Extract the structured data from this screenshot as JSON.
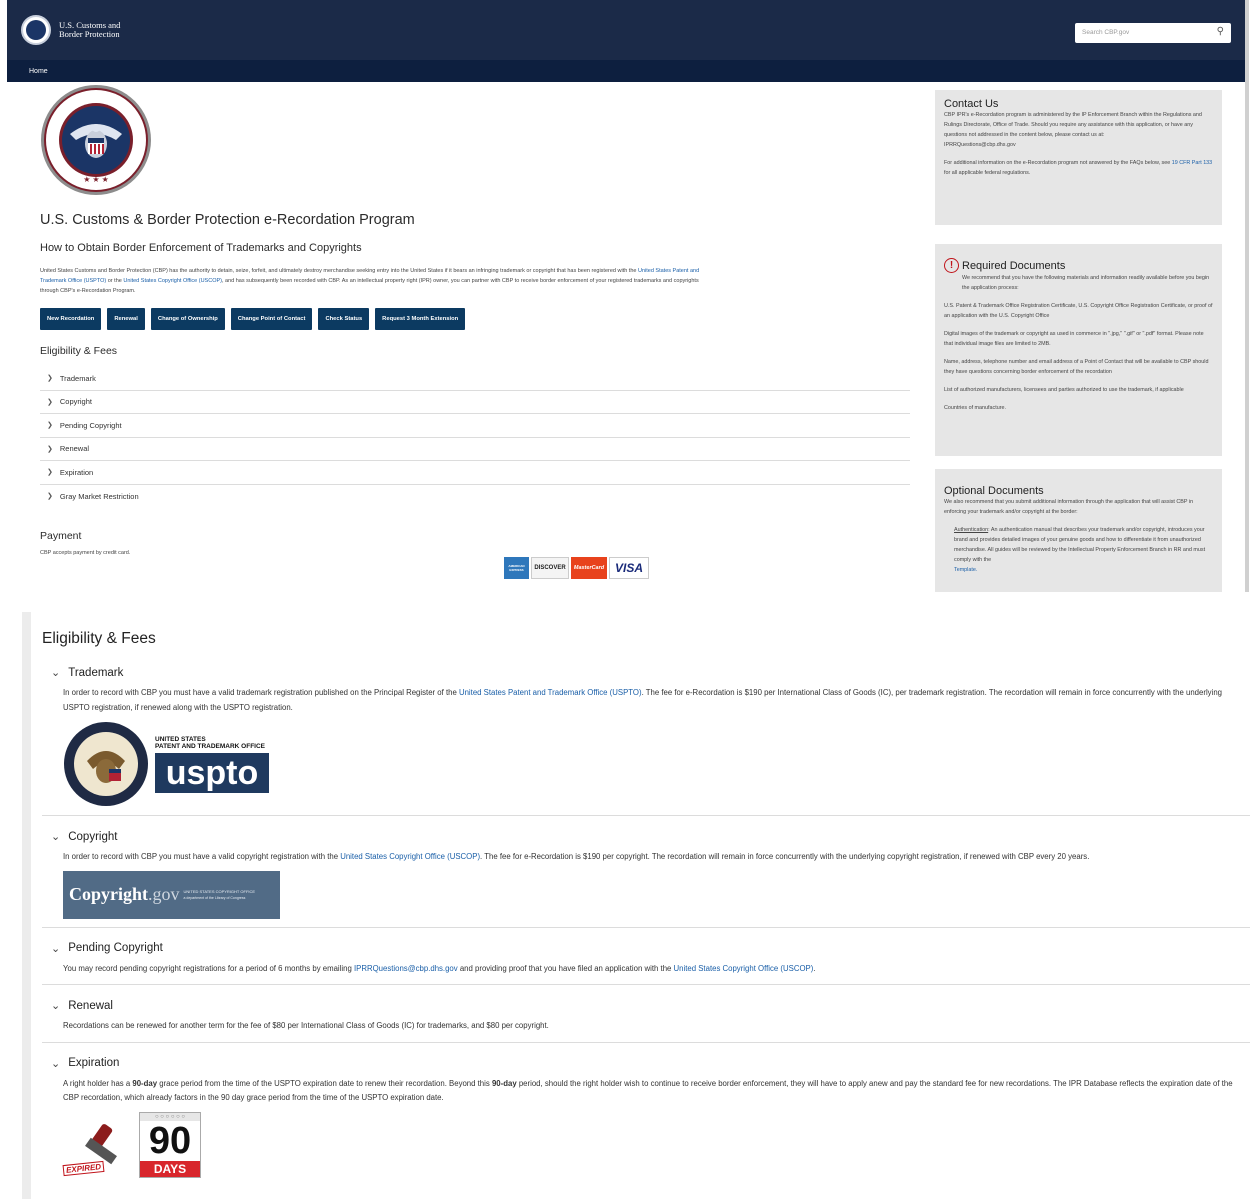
{
  "header": {
    "brand_line1": "U.S. Customs and",
    "brand_line2": "Border Protection",
    "search_placeholder": "Search CBP.gov",
    "nav_home": "Home"
  },
  "main": {
    "logo_text_top": "CUSTOMS AND BORDER PROTECTION",
    "logo_text_bottom": "TRADE",
    "title": "U.S. Customs & Border Protection e-Recordation Program",
    "subtitle": "How to Obtain Border Enforcement of Trademarks and Copyrights",
    "intro_1": "United States Customs and Border Protection (CBP) has the authority to detain, seize, forfeit, and ultimately destroy merchandise seeking entry into the United States if it bears an infringing trademark or copyright that has been registered with the ",
    "intro_link1": "United States Patent and Trademark Office (USPTO)",
    "intro_2": " or the ",
    "intro_link2": "United States Copyright Office (USCOP)",
    "intro_3": ", and has subsequently been recorded with CBP. As an intellectual property right (IPR) owner, you can partner with CBP to receive border enforcement of your registered trademarks and copyrights through CBP's e-Recordation Program.",
    "buttons": [
      "New Recordation",
      "Renewal",
      "Change of Ownership",
      "Change Point of Contact",
      "Check Status",
      "Request 3 Month Extension"
    ],
    "eligibility_title": "Eligibility & Fees",
    "accordion": [
      "Trademark",
      "Copyright",
      "Pending Copyright",
      "Renewal",
      "Expiration",
      "Gray Market Restriction"
    ],
    "payment_title": "Payment",
    "payment_text": "CBP accepts payment by credit card.",
    "cards": [
      "AMERICAN EXPRESS",
      "DISCOVER",
      "MasterCard",
      "VISA"
    ]
  },
  "sidebar": {
    "contact_title": "Contact Us",
    "contact_text": "CBP IPR's e-Recordation program is administered by the IP Enforcement Branch within the Regulations and Rulings Directorate, Office of Trade. Should you require any assistance with this application, or have any questions not addressed in the content below, please contact us at:",
    "contact_email": "IPRRQuestions@cbp.dhs.gov",
    "contact_more_1": "For additional information on the e-Recordation program not answered by the FAQs below, see ",
    "contact_more_link": "19 CFR Part 133",
    "contact_more_2": " for all applicable federal regulations.",
    "required_title": "Required Documents",
    "required_intro": "We recommend that you have the following materials and information readily available before you begin the application process:",
    "required_items": [
      "U.S. Patent & Trademark Office Registration Certificate, U.S. Copyright Office Registration Certificate, or proof of an application with the U.S. Copyright Office",
      "Digital images of the trademark or copyright as used in commerce in \".jpg,\" \".gif\" or \".pdf\" format. Please note that individual image files are limited to 2MB.",
      "Name, address, telephone number and email address of a Point of Contact that will be available to CBP should they have questions concerning border enforcement of the recordation",
      "List of authorized manufacturers, licensees and parties authorized to use the trademark, if applicable",
      "Countries of manufacture."
    ],
    "optional_title": "Optional Documents",
    "optional_intro": "We also recommend that you submit additional information through the application that will assist CBP in enforcing your trademark and/or copyright at the border:",
    "optional_auth_label": "Authentication",
    "optional_auth_text": ": An authentication manual that describes your trademark and/or copyright, introduces your brand and provides detailed images of your genuine goods and how to differentiate it from unauthorized merchandise. All guides will be reviewed by the Intellectual Property Enforcement Branch in RR and must comply with the ",
    "optional_template": "Template."
  },
  "expanded": {
    "title": "Eligibility & Fees",
    "trademark": {
      "label": "Trademark",
      "text_1": "In order to record with CBP you must have a valid trademark registration published on the Principal Register of the ",
      "link": "United States Patent and Trademark Office (USPTO)",
      "text_2": ". The fee for e-Recordation is $190 per International Class of Goods (IC), per trademark registration. The recordation will remain in force concurrently with the underlying USPTO registration, if renewed along with the USPTO registration.",
      "logo_small": "UNITED STATES\nPATENT AND TRADEMARK OFFICE",
      "logo_big": "uspto"
    },
    "copyright": {
      "label": "Copyright",
      "text_1": "In order to record with CBP you must have a valid copyright registration with the ",
      "link": "United States Copyright Office (USCOP)",
      "text_2": ". The fee for e-Recordation is $190 per copyright. The recordation will remain in force concurrently with the underlying copyright registration, if renewed with CBP every 20 years.",
      "logo_main": "Copyright",
      "logo_gov": ".gov",
      "logo_sub": "UNITED STATES COPYRIGHT OFFICE",
      "logo_sub2": "a department of the Library of Congress"
    },
    "pending": {
      "label": "Pending Copyright",
      "text_1": "You may record pending copyright registrations for a period of 6 months by emailing ",
      "link1": "IPRRQuestions@cbp.dhs.gov",
      "text_2": " and providing proof that you have filed an application with the ",
      "link2": "United States Copyright Office (USCOP)",
      "text_3": "."
    },
    "renewal": {
      "label": "Renewal",
      "text": "Recordations can be renewed for another term for the fee of $80 per International Class of Goods (IC) for trademarks, and $80 per copyright."
    },
    "expiration": {
      "label": "Expiration",
      "text_1": "A right holder has a ",
      "bold1": "90-day",
      "text_2": " grace period from the time of the USPTO expiration date to renew their recordation. Beyond this ",
      "bold2": "90-day",
      "text_3": " period, should the right holder wish to continue to receive border enforcement, they will have to apply anew and pay the standard fee for new recordations. The IPR Database reflects the expiration date of the CBP recordation, which already factors in the 90 day grace period from the time of the USPTO expiration date.",
      "stamp": "EXPIRED",
      "cal_num": "90",
      "cal_word": "DAYS"
    }
  }
}
